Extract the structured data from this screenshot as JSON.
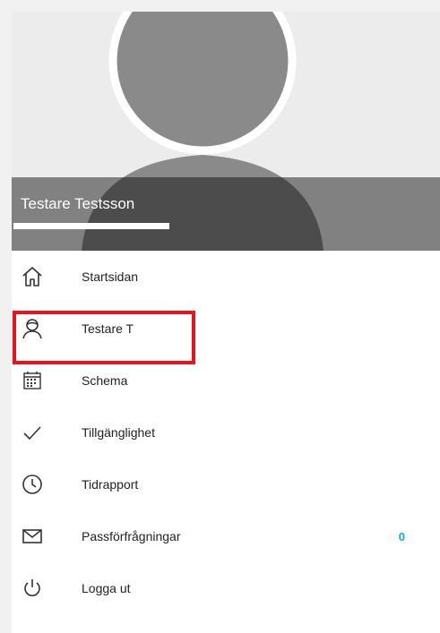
{
  "profile": {
    "name": "Testare Testsson",
    "email": "",
    "avatar_icon": "person-silhouette-icon"
  },
  "menu": {
    "items": [
      {
        "label": "Startsidan",
        "icon": "home-icon"
      },
      {
        "label": "Testare T",
        "icon": "profile-icon"
      },
      {
        "label": "Schema",
        "icon": "calendar-icon"
      },
      {
        "label": "Tillgänglighet",
        "icon": "check-icon"
      },
      {
        "label": "Tidrapport",
        "icon": "clock-icon"
      },
      {
        "label": "Passförfrågningar",
        "icon": "mail-icon",
        "badge": "0"
      },
      {
        "label": "Logga ut",
        "icon": "power-icon"
      }
    ]
  },
  "colors": {
    "highlight": "#e8131e",
    "badge": "#1ea1cf",
    "icon": "#333333"
  }
}
